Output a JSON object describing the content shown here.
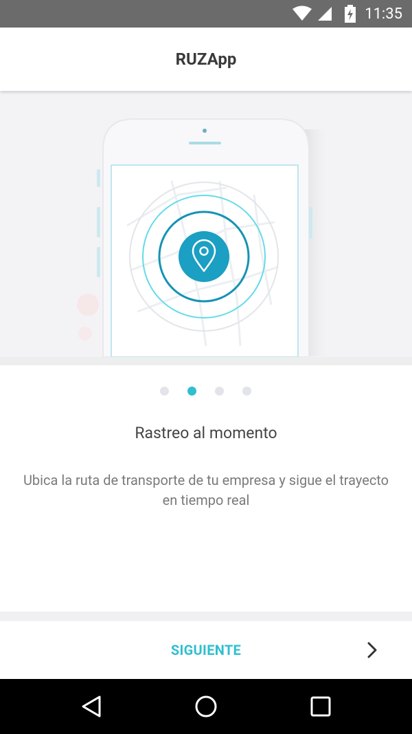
{
  "status_bar": {
    "time": "11:35",
    "icons": [
      "wifi-icon",
      "signal-icon",
      "battery-charging-icon"
    ]
  },
  "app_bar": {
    "title": "RUZApp"
  },
  "hero": {
    "illustration": "phone-with-location-pin",
    "icons": [
      "location-pin-icon"
    ]
  },
  "onboarding": {
    "pages": 4,
    "current_page": 2,
    "headline": "Rastreo al momento",
    "description": "Ubica la ruta de transporte de tu empresa y sigue el trayecto en tiempo real"
  },
  "footer": {
    "next_label": "SIGUIENTE",
    "next_icon": "chevron-right-icon"
  },
  "nav_bar": {
    "icons": [
      "back-icon",
      "home-icon",
      "recents-icon"
    ]
  },
  "colors": {
    "accent": "#2ebfd0",
    "pin_background": "#1b9fc2",
    "status_bar": "#6b6b6b",
    "hero_background": "#f3f3f5"
  }
}
